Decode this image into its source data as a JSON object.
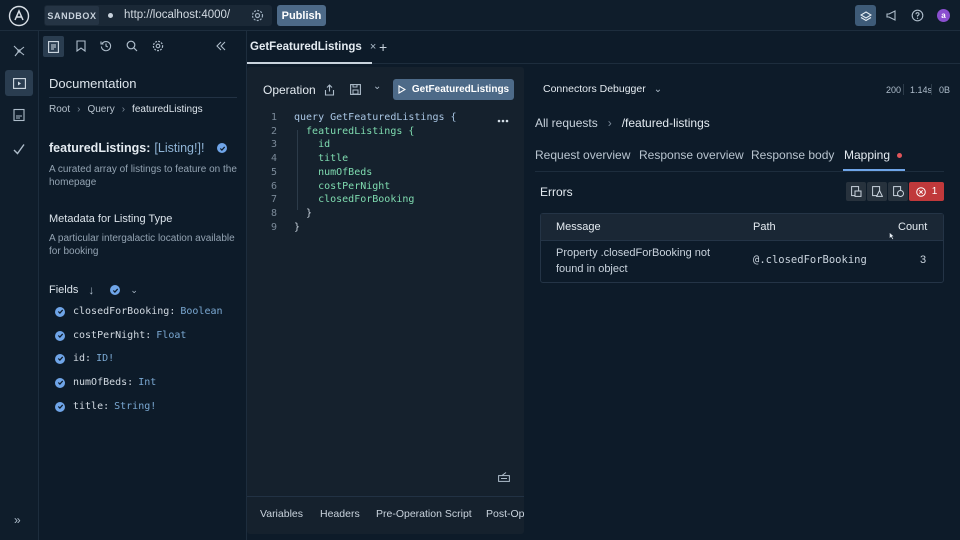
{
  "topbar": {
    "env_tag": "SANDBOX",
    "url": "http://localhost:4000/",
    "publish_label": "Publish",
    "avatar_initial": "a"
  },
  "tabs": {
    "active_label": "GetFeaturedListings",
    "close_glyph": "×",
    "add_glyph": "+"
  },
  "docs": {
    "title": "Documentation",
    "breadcrumb": [
      "Root",
      "Query",
      "featuredListings"
    ],
    "field_name": "featuredListings:",
    "field_type": "[Listing!]!",
    "field_desc": "A curated array of listings to feature on the homepage",
    "meta_title": "Metadata for Listing Type",
    "meta_desc": "A particular intergalactic location available for booking",
    "fields_label": "Fields",
    "fields": [
      {
        "name": "closedForBooking:",
        "type": "Boolean"
      },
      {
        "name": "costPerNight:",
        "type": "Float"
      },
      {
        "name": "id:",
        "type": "ID!"
      },
      {
        "name": "numOfBeds:",
        "type": "Int"
      },
      {
        "name": "title:",
        "type": "String!"
      }
    ],
    "expand_glyph": "»"
  },
  "operation": {
    "label": "Operation",
    "run_label": "GetFeaturedListings",
    "lines": [
      {
        "n": "1",
        "t": "query GetFeaturedListings {"
      },
      {
        "n": "2",
        "t": "  featuredListings {"
      },
      {
        "n": "3",
        "t": "    id"
      },
      {
        "n": "4",
        "t": "    title"
      },
      {
        "n": "5",
        "t": "    numOfBeds"
      },
      {
        "n": "6",
        "t": "    costPerNight"
      },
      {
        "n": "7",
        "t": "    closedForBooking"
      },
      {
        "n": "8",
        "t": "  }"
      },
      {
        "n": "9",
        "t": "}"
      }
    ],
    "bottom_tabs": [
      "Variables",
      "Headers",
      "Pre-Operation Script",
      "Post-Ope"
    ]
  },
  "debugger": {
    "title": "Connectors Debugger",
    "status": "200",
    "time": "1.14s",
    "size": "0B",
    "crumb_all": "All requests",
    "crumb_path": "/featured-listings",
    "tabs": [
      "Request overview",
      "Response overview",
      "Response body",
      "Mapping"
    ],
    "errors_title": "Errors",
    "error_count": "1",
    "table": {
      "headers": [
        "Message",
        "Path",
        "Count"
      ],
      "rows": [
        {
          "message": "Property .closedForBooking not found in object",
          "path": "@.closedForBooking",
          "count": "3"
        }
      ]
    }
  },
  "colors": {
    "accent_blue": "#6fa5e8",
    "error_red": "#c0393b",
    "mapping_dot": "#e0555a",
    "code_green": "#7fdcb0",
    "type_blue": "#7aa8d2"
  }
}
